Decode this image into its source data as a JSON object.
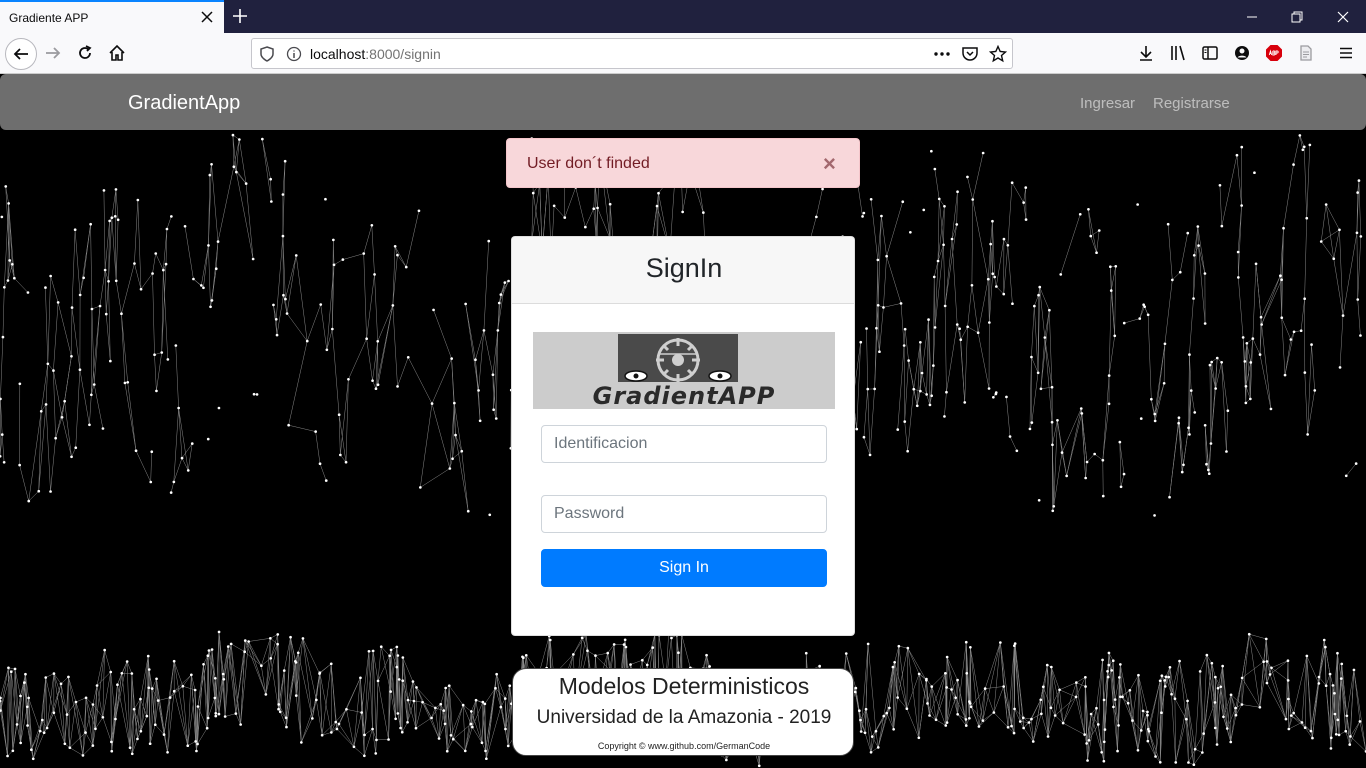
{
  "browser": {
    "tab_title": "Gradiente APP",
    "url_host": "localhost",
    "url_rest": ":8000/signin"
  },
  "app": {
    "brand": "GradientApp",
    "nav_links": [
      "Ingresar",
      "Registrarse"
    ]
  },
  "alert": {
    "message": "User don´t finded",
    "close_symbol": "×"
  },
  "signin": {
    "title": "SignIn",
    "logo_text": "GradientAPP",
    "id_placeholder": "Identificacion",
    "password_placeholder": "Password",
    "submit_label": "Sign In",
    "submit_color": "#007bff"
  },
  "footer": {
    "line1": "Modelos Deterministicos",
    "line2": "Universidad de la Amazonia - 2019",
    "line3": "Copyright © www.github.com/GermanCode"
  }
}
